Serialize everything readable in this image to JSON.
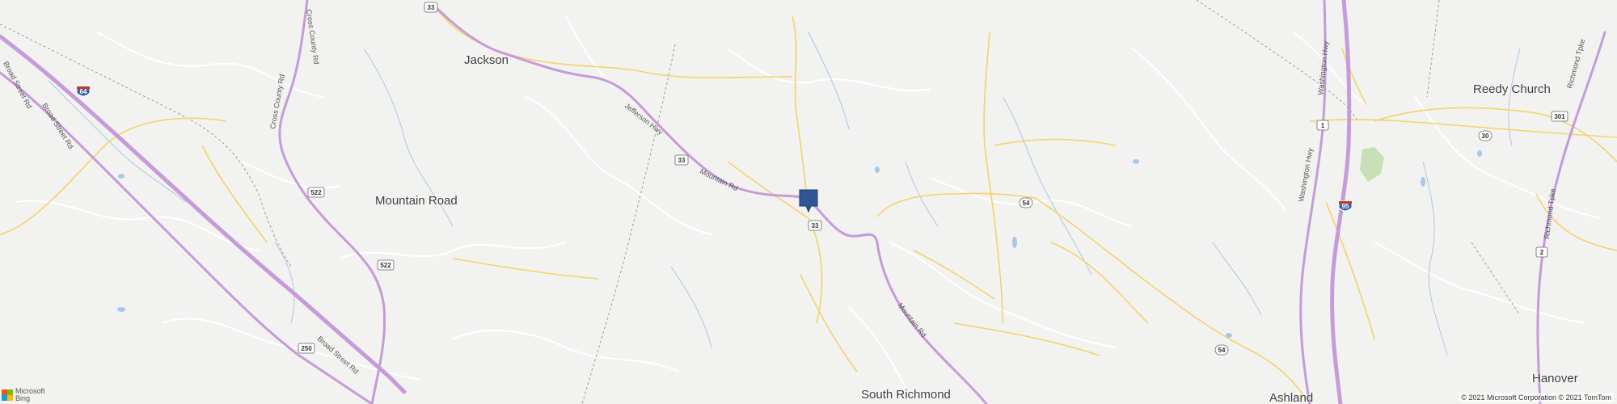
{
  "places": [
    {
      "name": "Jackson"
    },
    {
      "name": "Mountain Road"
    },
    {
      "name": "Reedy Church"
    },
    {
      "name": "South Richmond"
    },
    {
      "name": "Ashland"
    },
    {
      "name": "Hanover"
    }
  ],
  "roads": {
    "cross_county_rd": "Cross County Rd",
    "broad_street_rd": "Broad Street Rd",
    "jefferson_hwy": "Jefferson Hwy",
    "mountain_rd": "Mountain Rd",
    "washington_hwy": "Washington Hwy",
    "richmond_tpke": "Richmond Tpke"
  },
  "shields": {
    "us33": "33",
    "us522": "522",
    "i64": "64",
    "us250": "250",
    "rt54": "54",
    "us1": "1",
    "i95": "95",
    "rt30": "30",
    "us301": "301",
    "rt2": "2"
  },
  "attribution": {
    "copyright": "© 2021 Microsoft Corporation © 2021 TomTom",
    "logo_line1": "Microsoft",
    "logo_line2": "Bing"
  },
  "marker": {
    "icon": "location-pin-icon",
    "color": "#2f5597"
  },
  "colors": {
    "background": "#f2f2f0",
    "highway": "#c59bd9",
    "major_road": "#f3d36a",
    "water": "#a9c8e8",
    "park": "#c9dfb5",
    "minor_road": "#ffffff"
  }
}
